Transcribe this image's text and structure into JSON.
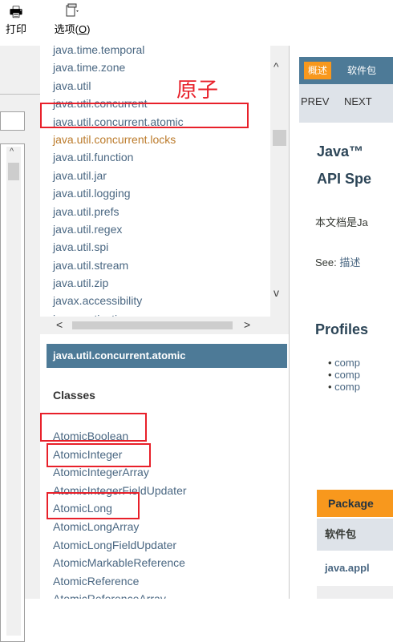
{
  "toolbar": {
    "print_label": "打印",
    "options_label_main": "选项(",
    "options_label_key": "O",
    "options_label_end": ")"
  },
  "packages": [
    "java.time.temporal",
    "java.time.zone",
    "java.util",
    "java.util.concurrent",
    "java.util.concurrent.atomic",
    "java.util.concurrent.locks",
    "java.util.function",
    "java.util.jar",
    "java.util.logging",
    "java.util.prefs",
    "java.util.regex",
    "java.util.spi",
    "java.util.stream",
    "java.util.zip",
    "javax.accessibility",
    "javax.activation"
  ],
  "highlighted_package_index": 5,
  "class_frame": {
    "header": "java.util.concurrent.atomic",
    "section_title": "Classes",
    "classes": [
      "AtomicBoolean",
      "AtomicInteger",
      "AtomicIntegerArray",
      "AtomicIntegerFieldUpdater",
      "AtomicLong",
      "AtomicLongArray",
      "AtomicLongFieldUpdater",
      "AtomicMarkableReference",
      "AtomicReference",
      "AtomicReferenceArray"
    ]
  },
  "content": {
    "nav_active": "概述",
    "nav_tab": "软件包",
    "prev": "PREV",
    "next": "NEXT",
    "title_line1": "Java™",
    "title_line2": "API Spe",
    "description": "本文档是Ja",
    "see_prefix": "See: ",
    "see_link": "描述",
    "profiles_heading": "Profiles",
    "profiles": [
      "comp",
      "comp",
      "comp"
    ],
    "package_tab": "Package",
    "package_col_header": "软件包",
    "package_row": "java.appl"
  },
  "annotation": {
    "label": "原子",
    "color": "#e8202a"
  }
}
